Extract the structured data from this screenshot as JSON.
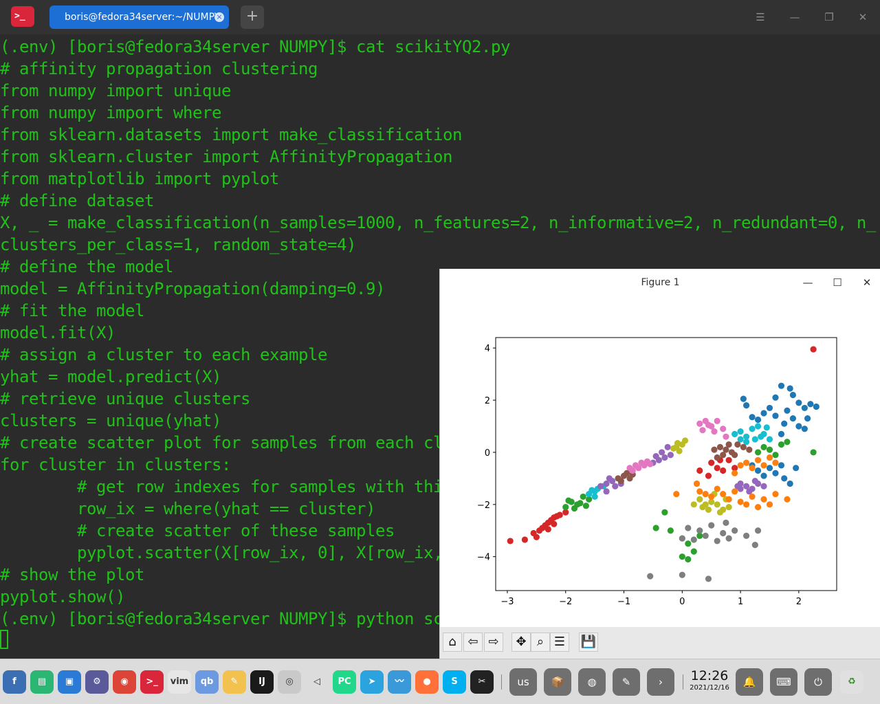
{
  "window": {
    "tab_title": "boris@fedora34server:~/NUMPY",
    "tab_close": "×",
    "new_tab": "+",
    "menu_icon": "☰",
    "minimize": "—",
    "restore": "❐",
    "close": "✕"
  },
  "terminal": {
    "lines": [
      "(.env) [boris@fedora34server NUMPY]$ cat scikitYQ2.py",
      "# affinity propagation clustering",
      "from numpy import unique",
      "from numpy import where",
      "from sklearn.datasets import make_classification",
      "from sklearn.cluster import AffinityPropagation",
      "from matplotlib import pyplot",
      "# define dataset",
      "X, _ = make_classification(n_samples=1000, n_features=2, n_informative=2, n_redundant=0, n_",
      "clusters_per_class=1, random_state=4)",
      "# define the model",
      "model = AffinityPropagation(damping=0.9)",
      "# fit the model",
      "model.fit(X)",
      "# assign a cluster to each example",
      "yhat = model.predict(X)",
      "# retrieve unique clusters",
      "clusters = unique(yhat)",
      "# create scatter plot for samples from each cl",
      "for cluster in clusters:",
      "        # get row indexes for samples with thi",
      "        row_ix = where(yhat == cluster)",
      "        # create scatter of these samples",
      "        pyplot.scatter(X[row_ix, 0], X[row_ix,",
      "# show the plot",
      "pyplot.show()",
      "(.env) [boris@fedora34server NUMPY]$ python sc"
    ]
  },
  "figure": {
    "title": "Figure 1",
    "minimize": "—",
    "maximize": "☐",
    "close": "✕",
    "toolbar": [
      {
        "name": "home-button",
        "glyph": "⌂"
      },
      {
        "name": "back-button",
        "glyph": "⇦"
      },
      {
        "name": "forward-button",
        "glyph": "⇨"
      },
      {
        "name": "pan-button",
        "glyph": "✥"
      },
      {
        "name": "zoom-button",
        "glyph": "⌕"
      },
      {
        "name": "configure-subplots-button",
        "glyph": "☰"
      },
      {
        "name": "save-button",
        "glyph": "💾"
      }
    ]
  },
  "chart_data": {
    "type": "scatter",
    "title": "",
    "xlabel": "",
    "ylabel": "",
    "xlim": [
      -3.2,
      2.65
    ],
    "ylim": [
      -5.3,
      4.4
    ],
    "xticks": [
      -3,
      -2,
      -1,
      0,
      1,
      2
    ],
    "yticks": [
      -4,
      -2,
      0,
      2,
      4
    ],
    "xtick_labels": [
      "−3",
      "−2",
      "−1",
      "0",
      "1",
      "2"
    ],
    "ytick_labels": [
      "−4",
      "−2",
      "0",
      "2",
      "4"
    ],
    "grid": false,
    "legend": "none",
    "series": [
      {
        "color": "#d62728",
        "points": [
          [
            -2.95,
            -3.4
          ],
          [
            -2.7,
            -3.35
          ],
          [
            -2.5,
            -3.25
          ],
          [
            -2.4,
            -2.9
          ],
          [
            -2.3,
            -2.7
          ],
          [
            -2.2,
            -2.5
          ],
          [
            -2.1,
            -2.4
          ],
          [
            -2.0,
            -2.3
          ],
          [
            -2.45,
            -3.0
          ],
          [
            -2.35,
            -2.8
          ],
          [
            -2.25,
            -2.6
          ],
          [
            -2.15,
            -2.45
          ],
          [
            -2.55,
            -3.1
          ],
          [
            -2.3,
            -2.95
          ],
          [
            -2.2,
            -2.75
          ],
          [
            2.25,
            3.95
          ],
          [
            0.5,
            -0.4
          ],
          [
            0.6,
            -0.6
          ],
          [
            0.7,
            -0.7
          ],
          [
            0.45,
            -0.9
          ],
          [
            0.8,
            -0.3
          ],
          [
            0.9,
            -0.6
          ],
          [
            0.3,
            -0.7
          ],
          [
            0.65,
            -0.3
          ]
        ]
      },
      {
        "color": "#2ca02c",
        "points": [
          [
            -2.0,
            -2.1
          ],
          [
            -1.9,
            -1.9
          ],
          [
            -1.8,
            -2.0
          ],
          [
            -1.7,
            -1.7
          ],
          [
            -1.85,
            -2.15
          ],
          [
            -1.6,
            -1.8
          ],
          [
            -1.95,
            -1.85
          ],
          [
            -1.75,
            -1.95
          ],
          [
            -1.65,
            -2.05
          ],
          [
            0.1,
            -3.5
          ],
          [
            0.2,
            -3.8
          ],
          [
            0.0,
            -4.0
          ],
          [
            0.3,
            -3.2
          ],
          [
            -0.2,
            -3.0
          ],
          [
            -0.45,
            -2.9
          ],
          [
            2.25,
            0.0
          ],
          [
            1.5,
            0.1
          ],
          [
            1.7,
            0.3
          ],
          [
            1.6,
            -0.1
          ],
          [
            1.3,
            0.0
          ],
          [
            1.8,
            0.4
          ],
          [
            1.4,
            0.2
          ],
          [
            -0.3,
            -2.3
          ],
          [
            0.1,
            -4.1
          ]
        ]
      },
      {
        "color": "#17becf",
        "points": [
          [
            -1.6,
            -1.6
          ],
          [
            -1.5,
            -1.5
          ],
          [
            -1.45,
            -1.4
          ],
          [
            -1.55,
            -1.45
          ],
          [
            -1.35,
            -1.3
          ],
          [
            -1.5,
            -1.7
          ],
          [
            0.9,
            0.7
          ],
          [
            1.0,
            0.8
          ],
          [
            1.1,
            0.6
          ],
          [
            1.2,
            0.9
          ],
          [
            1.3,
            1.0
          ],
          [
            1.4,
            0.7
          ],
          [
            1.5,
            0.5
          ],
          [
            1.1,
            0.4
          ],
          [
            1.0,
            0.5
          ],
          [
            1.25,
            0.5
          ],
          [
            1.45,
            0.95
          ],
          [
            1.35,
            0.6
          ]
        ]
      },
      {
        "color": "#9467bd",
        "points": [
          [
            -1.4,
            -1.3
          ],
          [
            -1.3,
            -1.2
          ],
          [
            -1.2,
            -1.1
          ],
          [
            -1.3,
            -1.5
          ],
          [
            -1.15,
            -1.3
          ],
          [
            -1.05,
            -1.2
          ],
          [
            -1.25,
            -1.0
          ],
          [
            -0.5,
            -0.4
          ],
          [
            -0.4,
            -0.3
          ],
          [
            -0.3,
            -0.2
          ],
          [
            -0.35,
            0.0
          ],
          [
            -0.2,
            -0.1
          ],
          [
            -0.25,
            0.2
          ],
          [
            -0.45,
            -0.15
          ],
          [
            1.0,
            -1.2
          ],
          [
            1.1,
            -1.3
          ],
          [
            1.2,
            -1.4
          ],
          [
            1.3,
            -1.2
          ],
          [
            1.15,
            -1.5
          ],
          [
            1.0,
            -1.4
          ],
          [
            1.4,
            -1.3
          ],
          [
            1.25,
            -1.1
          ],
          [
            0.95,
            -1.3
          ]
        ]
      },
      {
        "color": "#8c564b",
        "points": [
          [
            -1.1,
            -1.0
          ],
          [
            -1.0,
            -0.9
          ],
          [
            -0.9,
            -1.0
          ],
          [
            -0.95,
            -0.8
          ],
          [
            -0.85,
            -0.85
          ],
          [
            -1.05,
            -1.1
          ],
          [
            0.55,
            0.1
          ],
          [
            0.65,
            0.2
          ],
          [
            0.75,
            0.1
          ],
          [
            0.85,
            0.0
          ],
          [
            0.95,
            0.3
          ],
          [
            1.05,
            0.2
          ],
          [
            0.7,
            -0.1
          ],
          [
            0.6,
            -0.2
          ],
          [
            0.8,
            0.3
          ],
          [
            0.9,
            -0.1
          ],
          [
            1.15,
            0.1
          ]
        ]
      },
      {
        "color": "#e377c2",
        "points": [
          [
            -0.9,
            -0.6
          ],
          [
            -0.8,
            -0.5
          ],
          [
            -0.7,
            -0.4
          ],
          [
            -0.6,
            -0.35
          ],
          [
            -0.85,
            -0.7
          ],
          [
            -0.75,
            -0.6
          ],
          [
            -0.65,
            -0.5
          ],
          [
            -0.55,
            -0.45
          ],
          [
            0.3,
            1.1
          ],
          [
            0.4,
            1.2
          ],
          [
            0.5,
            1.0
          ],
          [
            0.6,
            1.2
          ],
          [
            0.7,
            0.9
          ],
          [
            0.75,
            0.6
          ],
          [
            0.35,
            0.85
          ],
          [
            0.45,
            1.05
          ],
          [
            0.55,
            0.8
          ]
        ]
      },
      {
        "color": "#bcbd22",
        "points": [
          [
            -0.1,
            0.2
          ],
          [
            0.0,
            0.3
          ],
          [
            0.05,
            0.45
          ],
          [
            -0.05,
            0.05
          ],
          [
            -0.15,
            0.15
          ],
          [
            -0.08,
            0.35
          ],
          [
            0.3,
            -1.8
          ],
          [
            0.4,
            -2.0
          ],
          [
            0.5,
            -1.9
          ],
          [
            0.6,
            -2.0
          ],
          [
            0.65,
            -2.3
          ],
          [
            0.7,
            -2.2
          ],
          [
            0.55,
            -1.6
          ],
          [
            0.45,
            -2.2
          ],
          [
            0.35,
            -2.1
          ],
          [
            0.8,
            -2.1
          ],
          [
            0.2,
            -2.0
          ],
          [
            0.75,
            -1.8
          ]
        ]
      },
      {
        "color": "#1f77b4",
        "points": [
          [
            1.7,
            2.55
          ],
          [
            1.85,
            2.45
          ],
          [
            1.6,
            2.1
          ],
          [
            1.9,
            2.2
          ],
          [
            2.0,
            1.9
          ],
          [
            2.1,
            1.7
          ],
          [
            2.3,
            1.75
          ],
          [
            2.2,
            1.85
          ],
          [
            1.5,
            1.7
          ],
          [
            1.4,
            1.5
          ],
          [
            1.3,
            1.25
          ],
          [
            1.2,
            1.35
          ],
          [
            1.8,
            1.6
          ],
          [
            1.9,
            1.3
          ],
          [
            2.0,
            1.0
          ],
          [
            2.1,
            0.9
          ],
          [
            1.6,
            1.4
          ],
          [
            1.75,
            1.1
          ],
          [
            2.15,
            1.3
          ],
          [
            1.05,
            2.05
          ],
          [
            1.1,
            1.8
          ],
          [
            1.7,
            0.7
          ],
          [
            1.5,
            -0.6
          ],
          [
            1.4,
            -0.9
          ],
          [
            1.75,
            -1.0
          ],
          [
            1.95,
            -0.6
          ],
          [
            1.85,
            -1.2
          ],
          [
            1.2,
            -0.5
          ],
          [
            1.3,
            -0.7
          ],
          [
            1.7,
            -0.5
          ],
          [
            1.6,
            -0.8
          ]
        ]
      },
      {
        "color": "#ff7f0e",
        "points": [
          [
            0.3,
            -1.5
          ],
          [
            0.4,
            -1.6
          ],
          [
            0.5,
            -1.7
          ],
          [
            0.6,
            -1.4
          ],
          [
            0.7,
            -1.6
          ],
          [
            0.8,
            -1.8
          ],
          [
            0.9,
            -1.5
          ],
          [
            1.0,
            -1.9
          ],
          [
            1.1,
            -2.0
          ],
          [
            1.2,
            -1.7
          ],
          [
            1.3,
            -2.1
          ],
          [
            1.4,
            -1.8
          ],
          [
            1.5,
            -2.0
          ],
          [
            1.6,
            -1.6
          ],
          [
            1.0,
            -0.5
          ],
          [
            1.1,
            -0.4
          ],
          [
            1.2,
            -0.6
          ],
          [
            1.3,
            -0.3
          ],
          [
            1.4,
            -0.5
          ],
          [
            1.5,
            -0.2
          ],
          [
            1.6,
            -0.4
          ],
          [
            0.9,
            -0.8
          ],
          [
            1.8,
            -1.8
          ],
          [
            -0.1,
            -1.6
          ],
          [
            0.25,
            -1.2
          ]
        ]
      },
      {
        "color": "#7f7f7f",
        "points": [
          [
            0.1,
            -2.9
          ],
          [
            0.3,
            -3.0
          ],
          [
            0.5,
            -2.8
          ],
          [
            0.7,
            -3.1
          ],
          [
            0.9,
            -3.0
          ],
          [
            1.1,
            -3.2
          ],
          [
            0.4,
            -3.2
          ],
          [
            0.6,
            -3.4
          ],
          [
            0.8,
            -3.3
          ],
          [
            1.3,
            -3.0
          ],
          [
            1.25,
            -3.55
          ],
          [
            0.0,
            -3.3
          ],
          [
            -0.55,
            -4.75
          ],
          [
            0.0,
            -4.7
          ],
          [
            0.45,
            -4.85
          ],
          [
            0.75,
            -2.7
          ],
          [
            0.2,
            -3.35
          ]
        ]
      }
    ]
  },
  "taskbar": {
    "language": "us",
    "time": "12:26",
    "date": "2021/12/16",
    "apps": [
      {
        "name": "fedora-icon",
        "label": "f",
        "color": "#3c6eb4"
      },
      {
        "name": "file-manager-icon",
        "label": "▤",
        "color": "#2bb673"
      },
      {
        "name": "app-store-icon",
        "label": "▣",
        "color": "#2b7bd6"
      },
      {
        "name": "settings-icon",
        "label": "⚙",
        "color": "#5a5a9a"
      },
      {
        "name": "chrome-icon",
        "label": "◉",
        "color": "#db4437"
      },
      {
        "name": "terminal-icon",
        "label": ">_",
        "color": "#d9263b"
      },
      {
        "name": "vim-icon",
        "label": "vim",
        "color": "#e6e6e6"
      },
      {
        "name": "qbittorrent-icon",
        "label": "qb",
        "color": "#6b9ae0"
      },
      {
        "name": "notes-icon",
        "label": "✎",
        "color": "#f2c14e"
      },
      {
        "name": "intellij-icon",
        "label": "IJ",
        "color": "#1a1a1a"
      },
      {
        "name": "disc-icon",
        "label": "◎",
        "color": "#c9c9c9"
      },
      {
        "name": "volume-icon",
        "label": "◁",
        "color": "#dcdcdc"
      },
      {
        "name": "pycharm-icon",
        "label": "PC",
        "color": "#21d789"
      },
      {
        "name": "telegram-icon",
        "label": "➤",
        "color": "#2aa3df"
      },
      {
        "name": "monitor-icon",
        "label": "〰",
        "color": "#3a9ad9"
      },
      {
        "name": "firefox-icon",
        "label": "●",
        "color": "#ff7139"
      },
      {
        "name": "skype-icon",
        "label": "S",
        "color": "#00aff0"
      },
      {
        "name": "screenshot-icon",
        "label": "✂",
        "color": "#222222"
      }
    ]
  }
}
